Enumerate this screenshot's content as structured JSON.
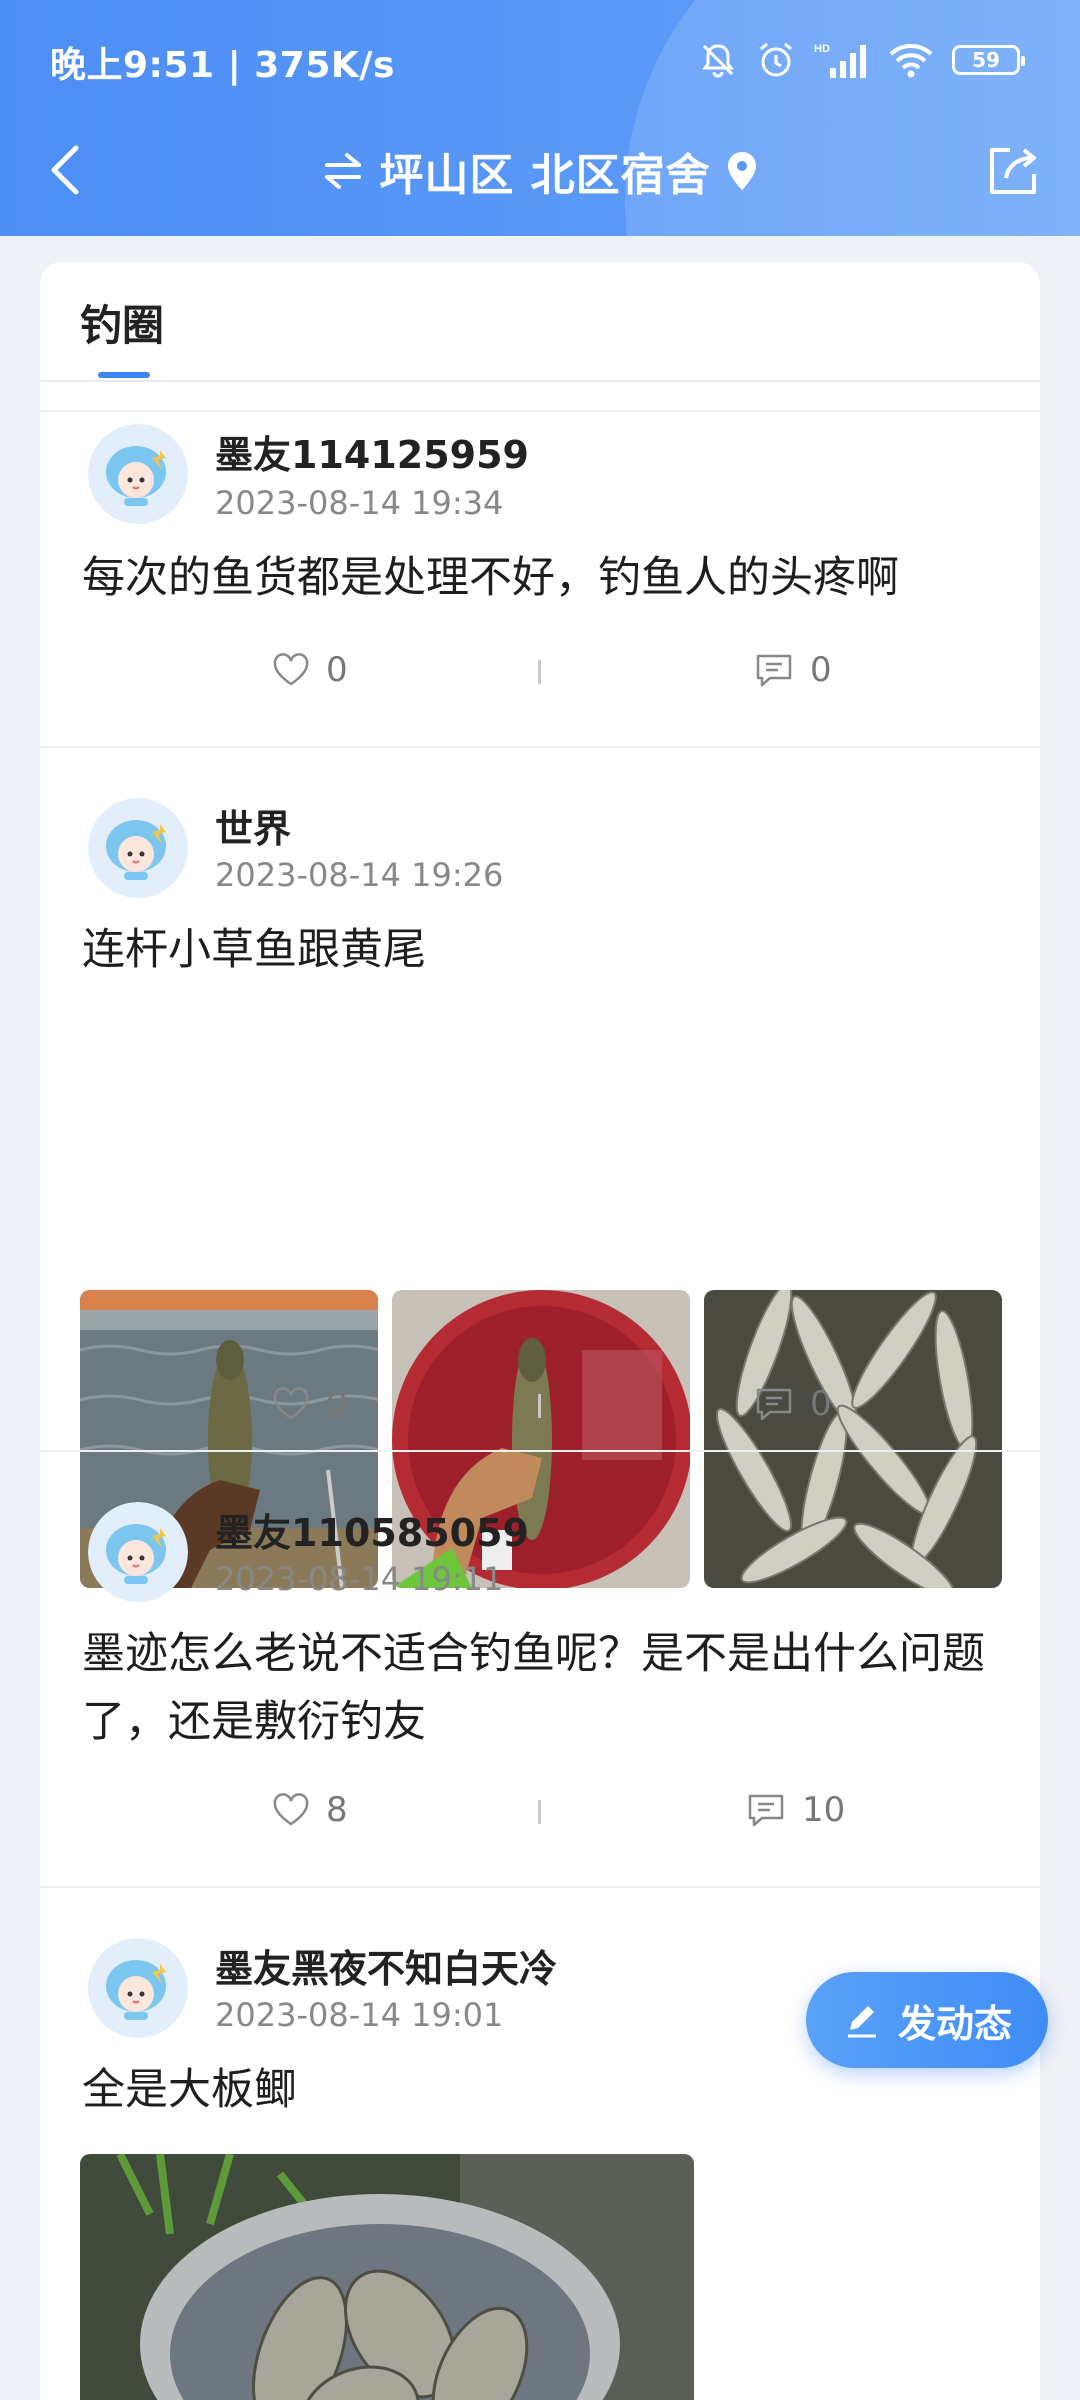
{
  "status_bar": {
    "time_speed": "晚上9:51 | 375K/s",
    "battery": "59",
    "hd_label": "HD"
  },
  "nav": {
    "location": "坪山区 北区宿舍",
    "icons": [
      "back-icon",
      "swap-icon",
      "location-pin-icon",
      "share-icon"
    ]
  },
  "tabs": [
    {
      "label": "钓圈"
    }
  ],
  "posts": [
    {
      "username": "墨友114125959",
      "time": "2023-08-14  19:34",
      "text": "每次的鱼货都是处理不好，钓鱼人的头疼啊",
      "likes": "0",
      "comments": "0"
    },
    {
      "username": "世界",
      "time": "2023-08-14  19:26",
      "text": "连杆小草鱼跟黄尾",
      "likes": "0",
      "comments": "0",
      "images": [
        "fish-held-by-water",
        "fish-held-over-red-net",
        "pile-of-fish"
      ]
    },
    {
      "username": "墨友110585059",
      "time": "2023-08-14  19:11",
      "text": "墨迹怎么老说不适合钓鱼呢？是不是出什么问题了，还是敷衍钓友",
      "likes": "8",
      "comments": "10"
    },
    {
      "username": "墨友黑夜不知白天冷",
      "time": "2023-08-14  19:01",
      "text": "全是大板鲫",
      "images": [
        "fish-in-basin"
      ]
    }
  ],
  "fab": {
    "label": "发动态",
    "icon": "pen-icon"
  },
  "colors": {
    "brand": "#4d8ef5",
    "tab_indicator": "#3b86f3",
    "card_bg": "#ffffff",
    "page_bg": "#eef1f5"
  }
}
